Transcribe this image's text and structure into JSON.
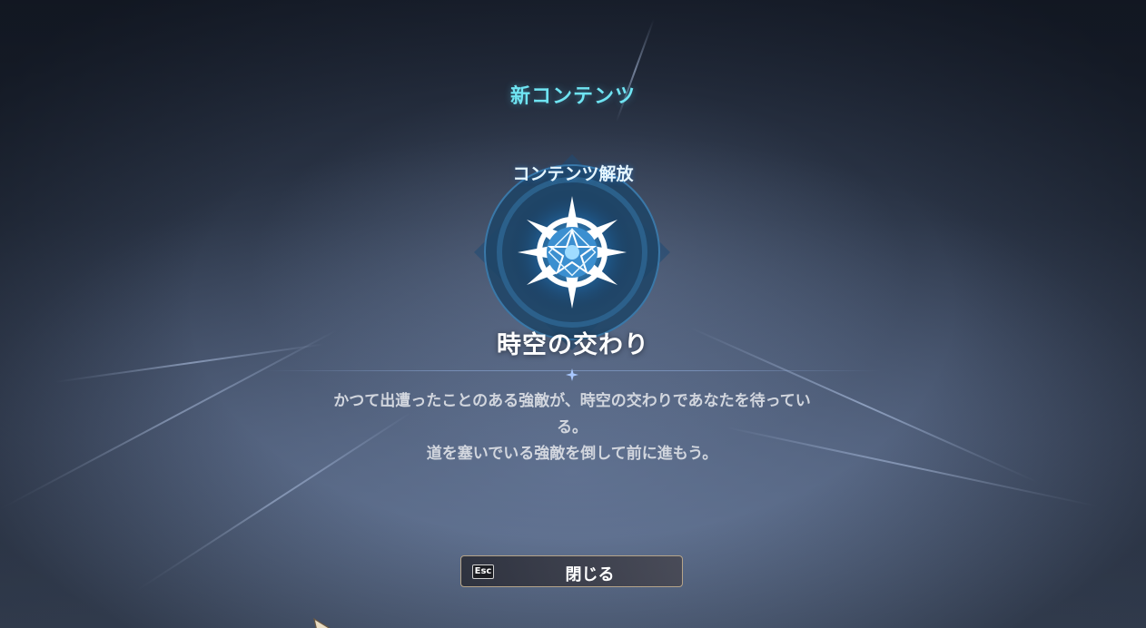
{
  "notification": {
    "header": "新コンテンツ",
    "unlock_label": "コンテンツ解放",
    "feature_name": "時空の交わり",
    "description_lines": [
      "かつて出遭ったことのある強敵が、時空の交わりであなたを待ってい",
      "る。",
      "道を塞いでいる強敵を倒して前に進もう。"
    ]
  },
  "close_button": {
    "key_hint": "Esc",
    "label": "閉じる"
  },
  "icons": {
    "emblem": "compass-star-emblem-icon",
    "divider_ornament": "four-point-star-icon",
    "cursor": "game-cursor-icon"
  },
  "colors": {
    "header": "#6fe4f2",
    "emblem_glow": "#2f8fd6",
    "button_border": "#b5a48a",
    "text_primary": "#ffffff",
    "text_secondary": "#d2d6de"
  }
}
